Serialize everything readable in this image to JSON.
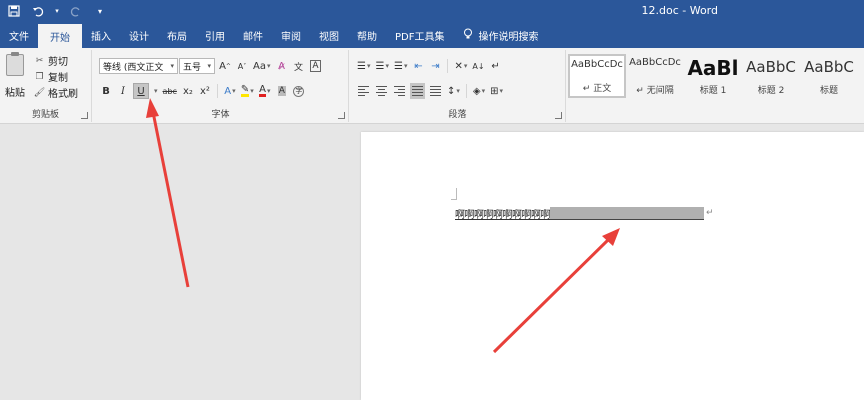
{
  "window": {
    "title": "12.doc - Word"
  },
  "qat": {
    "save_icon": "save-icon",
    "undo_icon": "undo-icon",
    "redo_icon": "redo-icon",
    "more_icon": "customize-icon"
  },
  "tabs": [
    {
      "label": "文件",
      "active": false
    },
    {
      "label": "开始",
      "active": true
    },
    {
      "label": "插入",
      "active": false
    },
    {
      "label": "设计",
      "active": false
    },
    {
      "label": "布局",
      "active": false
    },
    {
      "label": "引用",
      "active": false
    },
    {
      "label": "邮件",
      "active": false
    },
    {
      "label": "审阅",
      "active": false
    },
    {
      "label": "视图",
      "active": false
    },
    {
      "label": "帮助",
      "active": false
    },
    {
      "label": "PDF工具集",
      "active": false
    }
  ],
  "tell_me": {
    "label": "操作说明搜索"
  },
  "clipboard": {
    "paste": "粘贴",
    "cut": "剪切",
    "copy": "复制",
    "format_painter": "格式刷",
    "group_label": "剪贴板"
  },
  "font": {
    "font_name": "等线 (西文正文",
    "font_size": "五号",
    "grow": "A",
    "shrink": "A",
    "change_case": "Aa",
    "bold": "B",
    "italic": "I",
    "underline": "U",
    "strikethrough": "abc",
    "subscript": "x₂",
    "superscript": "x²",
    "group_label": "字体"
  },
  "paragraph": {
    "group_label": "段落"
  },
  "styles": [
    {
      "sample": "AaBbCcDc",
      "name": "↵ 正文",
      "selected": true
    },
    {
      "sample": "AaBbCcDc",
      "name": "↵ 无间隔",
      "selected": false
    },
    {
      "sample": "AaBl",
      "name": "标题 1",
      "selected": false
    },
    {
      "sample": "AaBbC",
      "name": "标题 2",
      "selected": false
    },
    {
      "sample": "AaBbC",
      "name": "标题",
      "selected": false
    }
  ],
  "document": {
    "text": "啊啊啊啊啊啊啊啊啊啊",
    "paragraph_mark": "↵"
  },
  "colors": {
    "ribbon_blue": "#2b579a",
    "annotation_red": "#e8403a",
    "highlight_gray": "#b0b0b0"
  }
}
